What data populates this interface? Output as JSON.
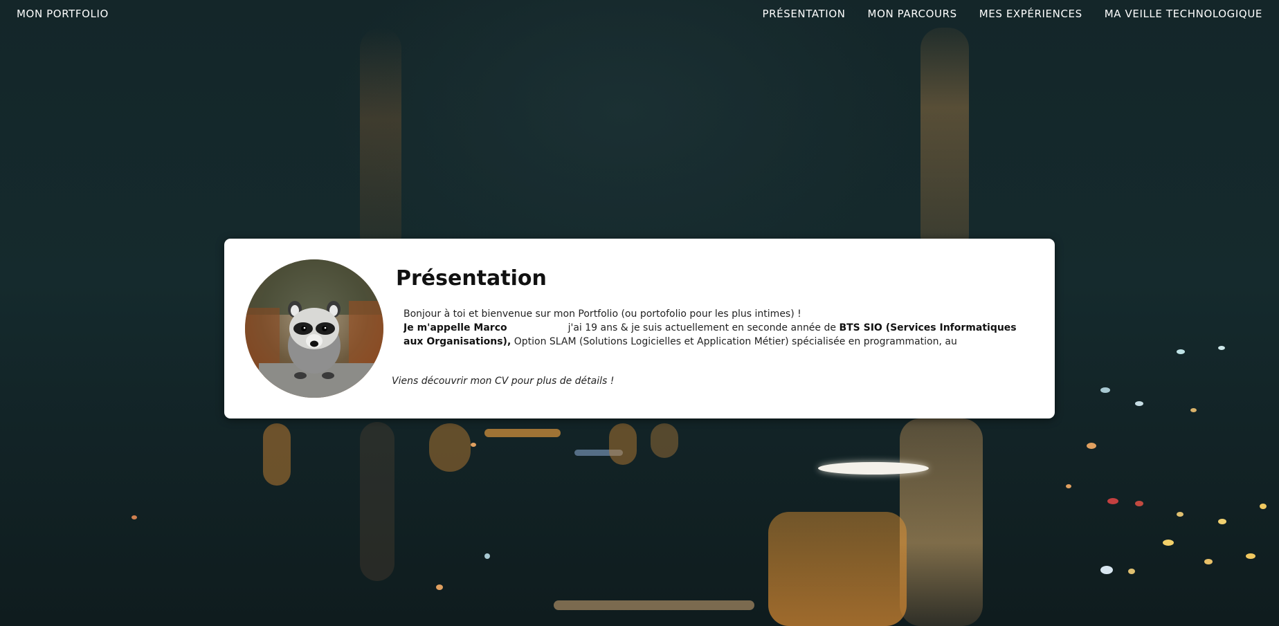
{
  "nav": {
    "brand": "MON PORTFOLIO",
    "items": [
      {
        "label": "PRÉSENTATION"
      },
      {
        "label": "MON PARCOURS"
      },
      {
        "label": "MES EXPÉRIENCES"
      },
      {
        "label": "MA VEILLE TECHNOLOGIQUE"
      }
    ]
  },
  "presentation": {
    "title": "Présentation",
    "greeting": "Bonjour à toi et bienvenue sur mon Portfolio (ou portofolio pour les plus intimes) !",
    "intro_bold": "Je m'appelle Marco",
    "age_text": "j'ai 19 ans & je suis actuellement en seconde année de ",
    "program_bold": "BTS SIO (Services Informatiques aux Organisations),",
    "option_text": " Option SLAM (Solutions Logicielles et Application Métier) spécialisée en programmation, au",
    "cta": "Viens découvrir mon CV pour plus de détails !"
  },
  "colors": {
    "background": "#15272a",
    "card": "#ffffff",
    "nav_text": "#ffffff"
  },
  "icons": {
    "avatar": "raccoon-photo"
  }
}
